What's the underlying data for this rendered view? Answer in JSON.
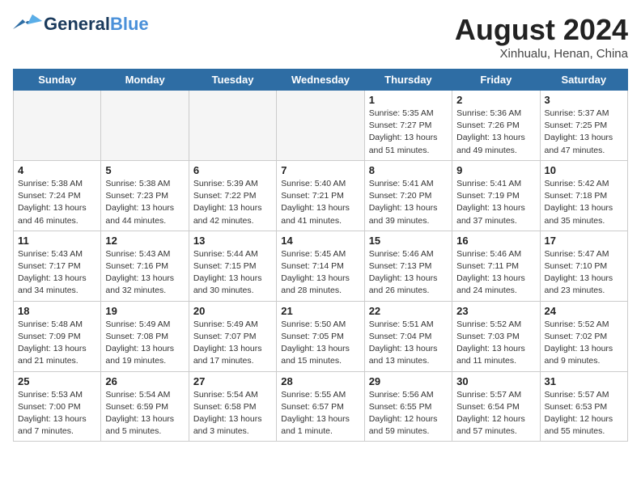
{
  "header": {
    "logo_general": "General",
    "logo_blue": "Blue",
    "month_title": "August 2024",
    "location": "Xinhualu, Henan, China"
  },
  "days_of_week": [
    "Sunday",
    "Monday",
    "Tuesday",
    "Wednesday",
    "Thursday",
    "Friday",
    "Saturday"
  ],
  "weeks": [
    [
      {
        "day": "",
        "info": ""
      },
      {
        "day": "",
        "info": ""
      },
      {
        "day": "",
        "info": ""
      },
      {
        "day": "",
        "info": ""
      },
      {
        "day": "1",
        "info": "Sunrise: 5:35 AM\nSunset: 7:27 PM\nDaylight: 13 hours\nand 51 minutes."
      },
      {
        "day": "2",
        "info": "Sunrise: 5:36 AM\nSunset: 7:26 PM\nDaylight: 13 hours\nand 49 minutes."
      },
      {
        "day": "3",
        "info": "Sunrise: 5:37 AM\nSunset: 7:25 PM\nDaylight: 13 hours\nand 47 minutes."
      }
    ],
    [
      {
        "day": "4",
        "info": "Sunrise: 5:38 AM\nSunset: 7:24 PM\nDaylight: 13 hours\nand 46 minutes."
      },
      {
        "day": "5",
        "info": "Sunrise: 5:38 AM\nSunset: 7:23 PM\nDaylight: 13 hours\nand 44 minutes."
      },
      {
        "day": "6",
        "info": "Sunrise: 5:39 AM\nSunset: 7:22 PM\nDaylight: 13 hours\nand 42 minutes."
      },
      {
        "day": "7",
        "info": "Sunrise: 5:40 AM\nSunset: 7:21 PM\nDaylight: 13 hours\nand 41 minutes."
      },
      {
        "day": "8",
        "info": "Sunrise: 5:41 AM\nSunset: 7:20 PM\nDaylight: 13 hours\nand 39 minutes."
      },
      {
        "day": "9",
        "info": "Sunrise: 5:41 AM\nSunset: 7:19 PM\nDaylight: 13 hours\nand 37 minutes."
      },
      {
        "day": "10",
        "info": "Sunrise: 5:42 AM\nSunset: 7:18 PM\nDaylight: 13 hours\nand 35 minutes."
      }
    ],
    [
      {
        "day": "11",
        "info": "Sunrise: 5:43 AM\nSunset: 7:17 PM\nDaylight: 13 hours\nand 34 minutes."
      },
      {
        "day": "12",
        "info": "Sunrise: 5:43 AM\nSunset: 7:16 PM\nDaylight: 13 hours\nand 32 minutes."
      },
      {
        "day": "13",
        "info": "Sunrise: 5:44 AM\nSunset: 7:15 PM\nDaylight: 13 hours\nand 30 minutes."
      },
      {
        "day": "14",
        "info": "Sunrise: 5:45 AM\nSunset: 7:14 PM\nDaylight: 13 hours\nand 28 minutes."
      },
      {
        "day": "15",
        "info": "Sunrise: 5:46 AM\nSunset: 7:13 PM\nDaylight: 13 hours\nand 26 minutes."
      },
      {
        "day": "16",
        "info": "Sunrise: 5:46 AM\nSunset: 7:11 PM\nDaylight: 13 hours\nand 24 minutes."
      },
      {
        "day": "17",
        "info": "Sunrise: 5:47 AM\nSunset: 7:10 PM\nDaylight: 13 hours\nand 23 minutes."
      }
    ],
    [
      {
        "day": "18",
        "info": "Sunrise: 5:48 AM\nSunset: 7:09 PM\nDaylight: 13 hours\nand 21 minutes."
      },
      {
        "day": "19",
        "info": "Sunrise: 5:49 AM\nSunset: 7:08 PM\nDaylight: 13 hours\nand 19 minutes."
      },
      {
        "day": "20",
        "info": "Sunrise: 5:49 AM\nSunset: 7:07 PM\nDaylight: 13 hours\nand 17 minutes."
      },
      {
        "day": "21",
        "info": "Sunrise: 5:50 AM\nSunset: 7:05 PM\nDaylight: 13 hours\nand 15 minutes."
      },
      {
        "day": "22",
        "info": "Sunrise: 5:51 AM\nSunset: 7:04 PM\nDaylight: 13 hours\nand 13 minutes."
      },
      {
        "day": "23",
        "info": "Sunrise: 5:52 AM\nSunset: 7:03 PM\nDaylight: 13 hours\nand 11 minutes."
      },
      {
        "day": "24",
        "info": "Sunrise: 5:52 AM\nSunset: 7:02 PM\nDaylight: 13 hours\nand 9 minutes."
      }
    ],
    [
      {
        "day": "25",
        "info": "Sunrise: 5:53 AM\nSunset: 7:00 PM\nDaylight: 13 hours\nand 7 minutes."
      },
      {
        "day": "26",
        "info": "Sunrise: 5:54 AM\nSunset: 6:59 PM\nDaylight: 13 hours\nand 5 minutes."
      },
      {
        "day": "27",
        "info": "Sunrise: 5:54 AM\nSunset: 6:58 PM\nDaylight: 13 hours\nand 3 minutes."
      },
      {
        "day": "28",
        "info": "Sunrise: 5:55 AM\nSunset: 6:57 PM\nDaylight: 13 hours\nand 1 minute."
      },
      {
        "day": "29",
        "info": "Sunrise: 5:56 AM\nSunset: 6:55 PM\nDaylight: 12 hours\nand 59 minutes."
      },
      {
        "day": "30",
        "info": "Sunrise: 5:57 AM\nSunset: 6:54 PM\nDaylight: 12 hours\nand 57 minutes."
      },
      {
        "day": "31",
        "info": "Sunrise: 5:57 AM\nSunset: 6:53 PM\nDaylight: 12 hours\nand 55 minutes."
      }
    ]
  ]
}
